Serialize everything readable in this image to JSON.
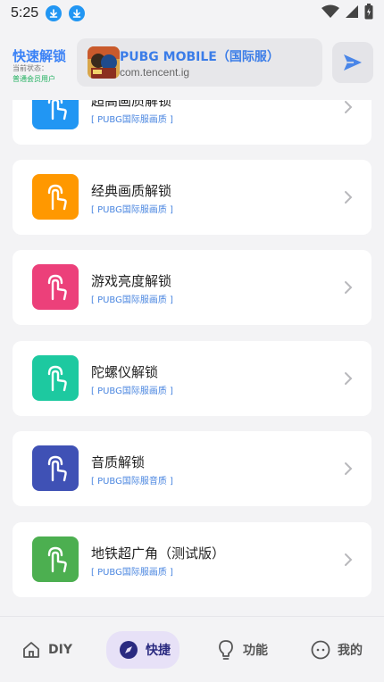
{
  "status_bar": {
    "time": "5:25"
  },
  "header": {
    "brand_title": "快速解锁",
    "status_label": "当前状态：",
    "status_value": "普通会员用户"
  },
  "game": {
    "name": "PUBG MOBILE（国际服）",
    "package": "com.tencent.ig"
  },
  "items": [
    {
      "title": "超高画质解锁",
      "subtitle": "[ PUBG国际服画质 ]",
      "color": "#2196f3"
    },
    {
      "title": "经典画质解锁",
      "subtitle": "[ PUBG国际服画质 ]",
      "color": "#ff9800"
    },
    {
      "title": "游戏亮度解锁",
      "subtitle": "[ PUBG国际服画质 ]",
      "color": "#ec407a"
    },
    {
      "title": "陀螺仪解锁",
      "subtitle": "[ PUBG国际服画质 ]",
      "color": "#1dc9a0"
    },
    {
      "title": "音质解锁",
      "subtitle": "[ PUBG国际服音质 ]",
      "color": "#3f51b5"
    },
    {
      "title": "地铁超广角（测试版）",
      "subtitle": "[ PUBG国际服画质 ]",
      "color": "#4caf50"
    }
  ],
  "nav": {
    "diy": "DIY",
    "shortcut": "快捷",
    "function": "功能",
    "mine": "我的"
  },
  "colors": {
    "accent": "#3b82f6",
    "nav_active_bg": "#e7e1f7"
  }
}
